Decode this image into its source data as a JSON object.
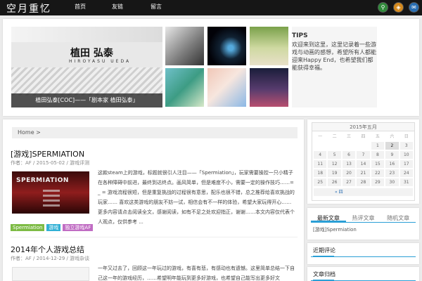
{
  "site": {
    "logo": "空月重忆"
  },
  "nav": [
    "首页",
    "友链",
    "留言"
  ],
  "social": [
    "search-icon",
    "rss-icon",
    "mail-icon"
  ],
  "featured": {
    "slide": {
      "name": "植田 弘泰",
      "roman": "HIROYASU UEDA",
      "caption": "植田弘泰[COC]——「剧本家 植田弘泰」"
    },
    "tips": {
      "title": "TIPS",
      "text": "欢迎来到这里，这里记录着一些游戏与动画的感想，希望所有人都能迎来Happy End，也希望我们都能获得幸福。"
    }
  },
  "main": {
    "breadcrumb": "Home >",
    "posts": [
      {
        "title": "[游戏]SPERMIATION",
        "meta": "作者：AF / 2015-05-02 / 游戏评测",
        "thumb_title": "SPERMIATION",
        "excerpt": "这款steam上的游戏，标题就很引人注目——「Spermiation」，玩家需要操控一只小精子在各种障碍中前进，最终到达终点。画风简单，但是难度不小，需要一定的操作技巧……= _ = 游戏流程很短，但是重复挑战的过程很有意思，配乐也很不错，总之推荐给喜欢挑战的玩家……   喜欢这类游戏的朋友不妨一试，相信会有不一样的体验，希望大家玩得开心……   更多内容请点击阅读全文，感谢阅读，如有不足之处欢迎指正，谢谢……本文内容仅代表个人观点，仅供参考 ...",
        "tags": [
          "Spermiation",
          "游戏",
          "独立游戏AF"
        ]
      },
      {
        "title": "2014年个人游戏总结",
        "meta": "作者：AF / 2014-12-29 / 游戏杂谈",
        "excerpt": "一年又过去了，回顾这一年玩过的游戏，有喜有悲，有感动也有遗憾。这里简单总结一下自己这一年的游戏经历，……希望明年能玩到更多好游戏，也希望自己能写出更多好文章……，更多内容待补完，以下是2014年游戏清单的简单整理，仅供参考。"
      }
    ]
  },
  "sidebar": {
    "calendar": {
      "title": "2015年五月",
      "weekdays": [
        "一",
        "二",
        "三",
        "四",
        "五",
        "六",
        "日"
      ],
      "days": [
        "",
        "",
        "",
        "",
        "1",
        "2",
        "3",
        "4",
        "5",
        "6",
        "7",
        "8",
        "9",
        "10",
        "11",
        "12",
        "13",
        "14",
        "15",
        "16",
        "17",
        "18",
        "19",
        "20",
        "21",
        "22",
        "23",
        "24",
        "25",
        "26",
        "27",
        "28",
        "29",
        "30",
        "31"
      ],
      "current_day": "2",
      "prev": "« 四"
    },
    "tabs": [
      "最新文章",
      "热评文章",
      "随机文章"
    ],
    "tab_content": "[游戏]Spermiation",
    "widgets": [
      "近期评论",
      "文章归档"
    ]
  },
  "colors": {
    "accent": "#2a9fd6",
    "topbar": "#161616"
  }
}
